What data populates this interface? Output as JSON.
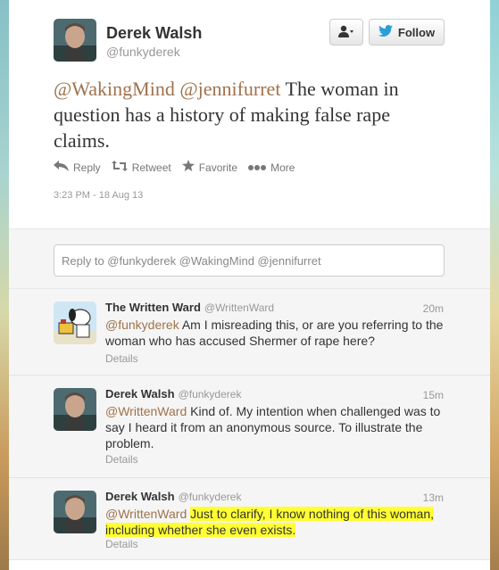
{
  "main_tweet": {
    "name": "Derek Walsh",
    "handle": "@funkyderek",
    "follow_label": "Follow",
    "mention1": "@WakingMind",
    "mention2": "@jennifurret",
    "text": "The woman in question has a history of making false rape claims.",
    "actions": {
      "reply": "Reply",
      "retweet": "Retweet",
      "favorite": "Favorite",
      "more": "More"
    },
    "timestamp": "3:23 PM - 18 Aug 13"
  },
  "reply_box": {
    "placeholder": "Reply to @funkyderek @WakingMind @jennifurret"
  },
  "replies": [
    {
      "name": "The Written Ward",
      "handle": "@WrittenWard",
      "time": "20m",
      "mention": "@funkyderek",
      "text": "Am I misreading this, or are you referring to the woman who has accused Shermer of rape here?",
      "details": "Details"
    },
    {
      "name": "Derek Walsh",
      "handle": "@funkyderek",
      "time": "15m",
      "mention": "@WrittenWard",
      "text": "Kind of. My intention when challenged was to say I heard it from an anonymous source. To illustrate the problem.",
      "details": "Details"
    },
    {
      "name": "Derek Walsh",
      "handle": "@funkyderek",
      "time": "13m",
      "mention": "@WrittenWard",
      "text": "Just to clarify, I know nothing of this woman, including whether she even exists.",
      "details": "Details"
    }
  ],
  "colors": {
    "mention": "#a0724c",
    "highlight": "#ffff33",
    "twitter_blue": "#2b9ed8"
  }
}
